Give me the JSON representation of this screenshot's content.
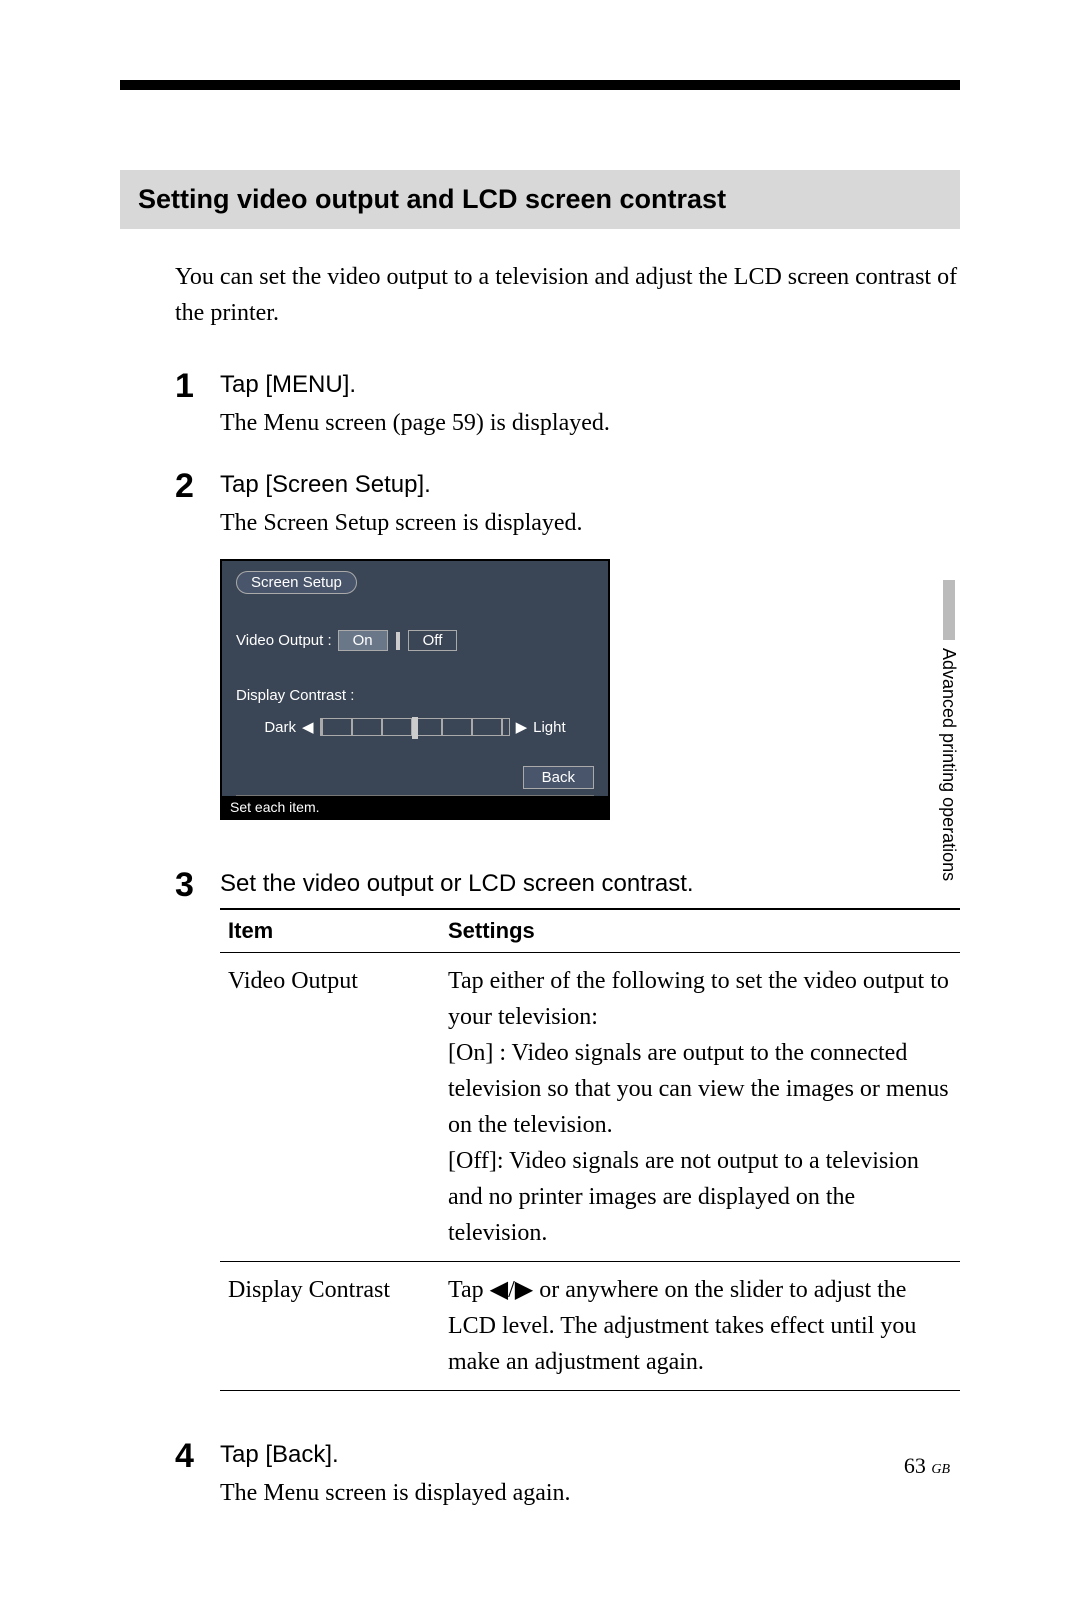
{
  "section_heading": "Setting video output and LCD screen contrast",
  "intro": "You can set the video output to a television and adjust the LCD screen contrast of the printer.",
  "steps": {
    "s1": {
      "num": "1",
      "title": "Tap [MENU].",
      "desc": "The Menu screen (page 59) is displayed."
    },
    "s2": {
      "num": "2",
      "title": "Tap [Screen Setup].",
      "desc": "The Screen Setup screen is displayed."
    },
    "s3": {
      "num": "3",
      "title": "Set the video output or LCD screen contrast."
    },
    "s4": {
      "num": "4",
      "title": "Tap [Back].",
      "desc": "The Menu screen is displayed again."
    }
  },
  "screen": {
    "tab": "Screen Setup",
    "video_label": "Video Output :",
    "on": "On",
    "off": "Off",
    "contrast_label": "Display Contrast :",
    "dark": "Dark",
    "light": "Light",
    "back": "Back",
    "status": "Set each item."
  },
  "table": {
    "headers": {
      "item": "Item",
      "settings": "Settings"
    },
    "rows": [
      {
        "item": "Video Output",
        "settings": "Tap either of the following to set the video output to your television:\n[On] :  Video signals are output to the connected television so that you can view the images or menus on the television.\n[Off]:  Video signals are not output to a television and no printer images are displayed on the television."
      },
      {
        "item": "Display Contrast",
        "settings": "Tap ◀/▶ or anywhere on the slider to adjust the LCD level.  The adjustment takes effect until you make an adjustment again."
      }
    ]
  },
  "side_tab": "Advanced printing operations",
  "page_number": "63",
  "page_region": "GB"
}
